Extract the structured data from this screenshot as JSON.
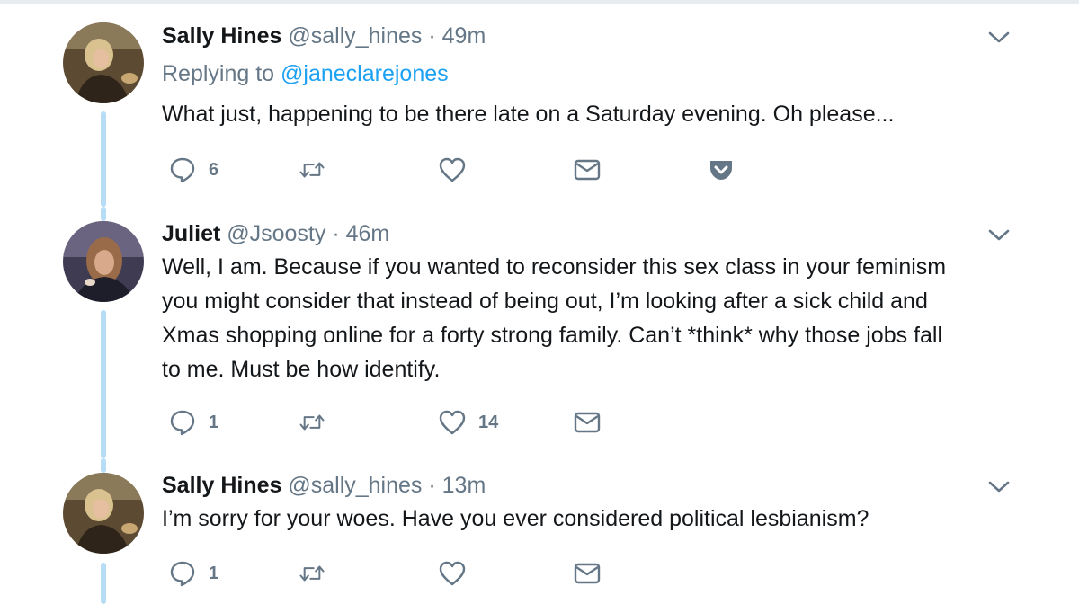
{
  "tweets": [
    {
      "name": "Sally Hines",
      "handle": "@sally_hines",
      "separator": "·",
      "time": "49m",
      "replying_prefix": "Replying to",
      "replying_to": "@janeclarejones",
      "text": "What just, happening to be there late on a Saturday evening. Oh please...",
      "reply_count": "6",
      "retweet_count": "",
      "like_count": ""
    },
    {
      "name": "Juliet",
      "handle": "@Jsoosty",
      "separator": "·",
      "time": "46m",
      "text_lines": [
        "Well, I am. Because if you wanted to reconsider this sex class in your feminism",
        "you might consider that instead of being out, I’m looking after a sick child and",
        "Xmas shopping online for a forty strong family. Can’t *think* why those jobs fall",
        "to me. Must be how identify."
      ],
      "reply_count": "1",
      "retweet_count": "",
      "like_count": "14"
    },
    {
      "name": "Sally Hines",
      "handle": "@sally_hines",
      "separator": "·",
      "time": "13m",
      "text": "I’m sorry for your woes. Have you ever considered political lesbianism?",
      "reply_count": "1",
      "retweet_count": "",
      "like_count": ""
    }
  ],
  "icons": [
    "reply-icon",
    "retweet-icon",
    "like-icon",
    "direct-message-icon",
    "pocket-icon",
    "chevron-down-icon"
  ],
  "colors": {
    "name": "#14171a",
    "secondary": "#657786",
    "link": "#1da1f2",
    "thread_line": "#b7dcf5",
    "icon": "#657786"
  }
}
